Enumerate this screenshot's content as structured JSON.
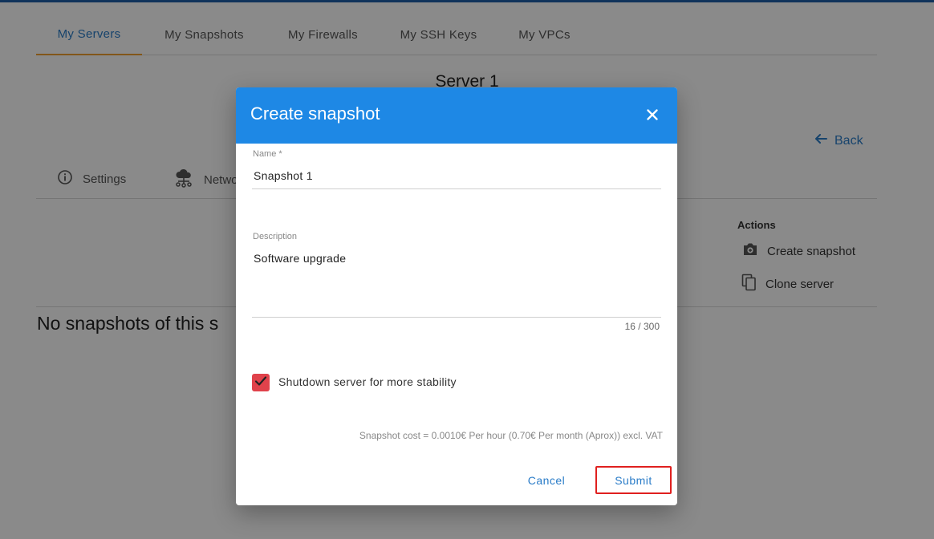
{
  "background": {
    "tabs": [
      {
        "label": "My Servers",
        "active": true
      },
      {
        "label": "My Snapshots",
        "active": false
      },
      {
        "label": "My Firewalls",
        "active": false
      },
      {
        "label": "My SSH Keys",
        "active": false
      },
      {
        "label": "My VPCs",
        "active": false
      }
    ],
    "server_title": "Server 1",
    "back_label": "Back",
    "subtabs": {
      "settings_label": "Settings",
      "network_label": "Netwo"
    },
    "actions": {
      "title": "Actions",
      "create_snapshot_label": "Create snapshot",
      "clone_server_label": "Clone server"
    },
    "empty_message": "No snapshots of this s"
  },
  "dialog": {
    "title": "Create snapshot",
    "name_field": {
      "label": "Name *",
      "value": "Snapshot 1"
    },
    "description_field": {
      "label": "Description",
      "value": "Software upgrade",
      "counter": "16 / 300"
    },
    "shutdown_checkbox": {
      "label": "Shutdown server for more stability",
      "checked": true
    },
    "cost_text": "Snapshot cost = 0.0010€ Per hour (0.70€ Per month (Aprox)) excl. VAT",
    "cancel_label": "Cancel",
    "submit_label": "Submit"
  },
  "colors": {
    "accent": "#1e88e5",
    "tab_indicator": "#f0a030",
    "checkbox": "#e0424b",
    "highlight_border": "#e0201f"
  }
}
